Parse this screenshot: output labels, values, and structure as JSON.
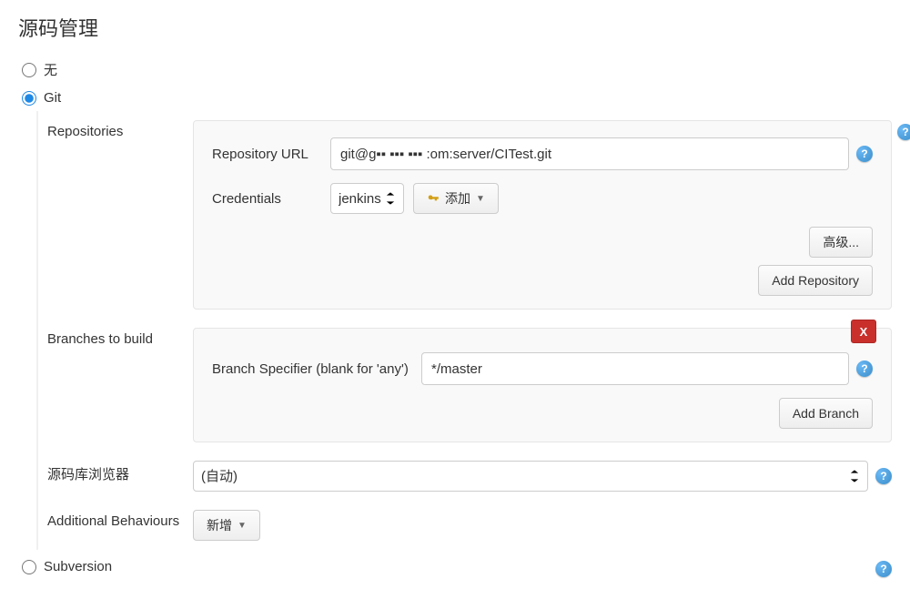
{
  "section_title": "源码管理",
  "scm_options": {
    "none": "无",
    "git": "Git",
    "subversion": "Subversion",
    "selected": "git"
  },
  "git": {
    "repositories_label": "Repositories",
    "repo_url_label": "Repository URL",
    "repo_url_value": "git@g▪▪ ▪▪▪ ▪▪▪ :om:server/CITest.git",
    "credentials_label": "Credentials",
    "credentials_selected": "jenkins",
    "add_credentials_label": "添加",
    "advanced_label": "高级...",
    "add_repository_label": "Add Repository",
    "branches_label": "Branches to build",
    "branch_specifier_label": "Branch Specifier (blank for 'any')",
    "branch_specifier_value": "*/master",
    "add_branch_label": "Add Branch",
    "delete_branch_label": "X",
    "browser_label": "源码库浏览器",
    "browser_selected": "(自动)",
    "additional_behaviours_label": "Additional Behaviours",
    "add_behaviour_label": "新增"
  },
  "help_char": "?"
}
